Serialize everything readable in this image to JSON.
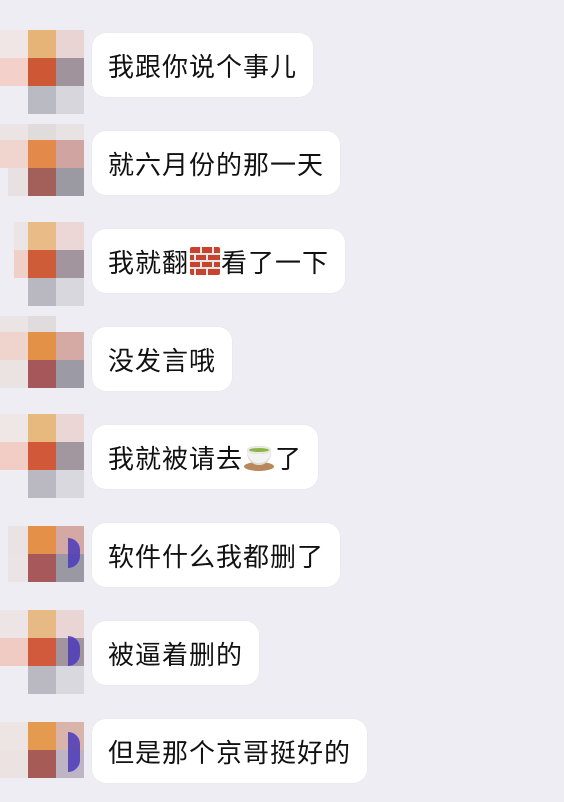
{
  "chat": {
    "messages": [
      {
        "text": "我跟你说个事儿"
      },
      {
        "text": "就六月份的那一天"
      },
      {
        "text_before": "我就翻",
        "emoji": "brick-emoji",
        "text_after": "看了一下"
      },
      {
        "text": "没发言哦"
      },
      {
        "text_before": "我就被请去",
        "emoji": "tea-emoji",
        "text_after": "了"
      },
      {
        "text": "软件什么我都删了"
      },
      {
        "text": "被逼着删的"
      },
      {
        "text": "但是那个京哥挺好的"
      }
    ]
  },
  "colors": {
    "background": "#ededf3",
    "bubble": "#ffffff",
    "text": "#111111"
  }
}
